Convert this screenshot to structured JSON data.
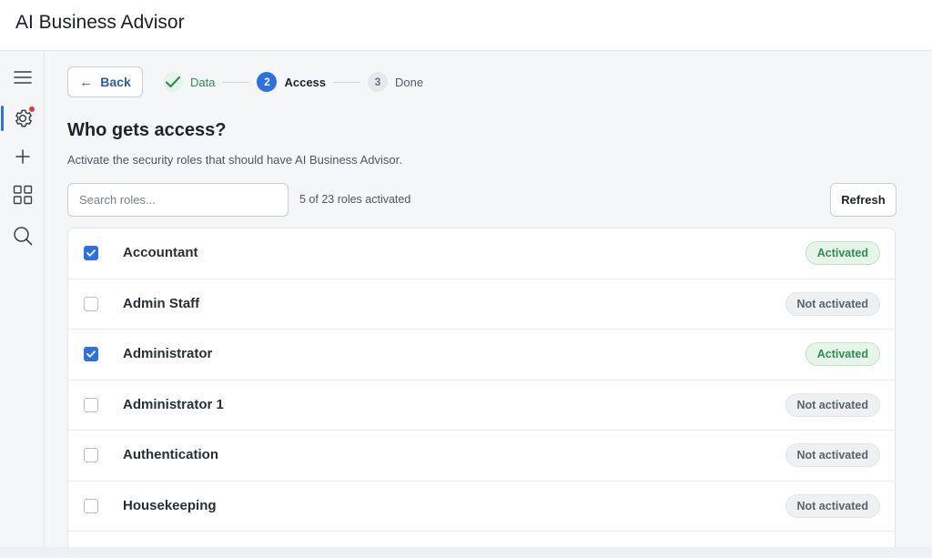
{
  "app": {
    "title": "AI Business Advisor"
  },
  "sidebar": {
    "items": [
      {
        "name": "menu",
        "icon": "hamburger-icon"
      },
      {
        "name": "settings",
        "icon": "gear-icon",
        "active": true,
        "notification": true
      },
      {
        "name": "add",
        "icon": "plus-icon"
      },
      {
        "name": "apps",
        "icon": "grid-icon"
      },
      {
        "name": "search",
        "icon": "search-icon"
      }
    ]
  },
  "header": {
    "back_label": "Back",
    "back_icon": "arrow-left-icon"
  },
  "stepper": {
    "steps": [
      {
        "number": "",
        "label": "Data",
        "state": "done",
        "icon": "checkmark-icon"
      },
      {
        "number": "2",
        "label": "Access",
        "state": "current"
      },
      {
        "number": "3",
        "label": "Done",
        "state": "todo"
      }
    ]
  },
  "page": {
    "title": "Who gets access?",
    "description": "Activate the security roles that should have AI Business Advisor."
  },
  "toolbar": {
    "search_placeholder": "Search roles...",
    "search_value": "",
    "count_text": "5 of 23 roles activated",
    "refresh_label": "Refresh"
  },
  "roles": [
    {
      "name": "Accountant",
      "checked": true,
      "status": "Activated"
    },
    {
      "name": "Admin Staff",
      "checked": false,
      "status": "Not activated"
    },
    {
      "name": "Administrator",
      "checked": true,
      "status": "Activated"
    },
    {
      "name": "Administrator 1",
      "checked": false,
      "status": "Not activated"
    },
    {
      "name": "Authentication",
      "checked": false,
      "status": "Not activated"
    },
    {
      "name": "Housekeeping",
      "checked": false,
      "status": "Not activated"
    }
  ],
  "colors": {
    "accent": "#2f6fe0",
    "activated_text": "#2e8f4f",
    "activated_bg": "#e7f4ea",
    "inactive_text": "#5c626b",
    "notification": "#e03b3b"
  }
}
